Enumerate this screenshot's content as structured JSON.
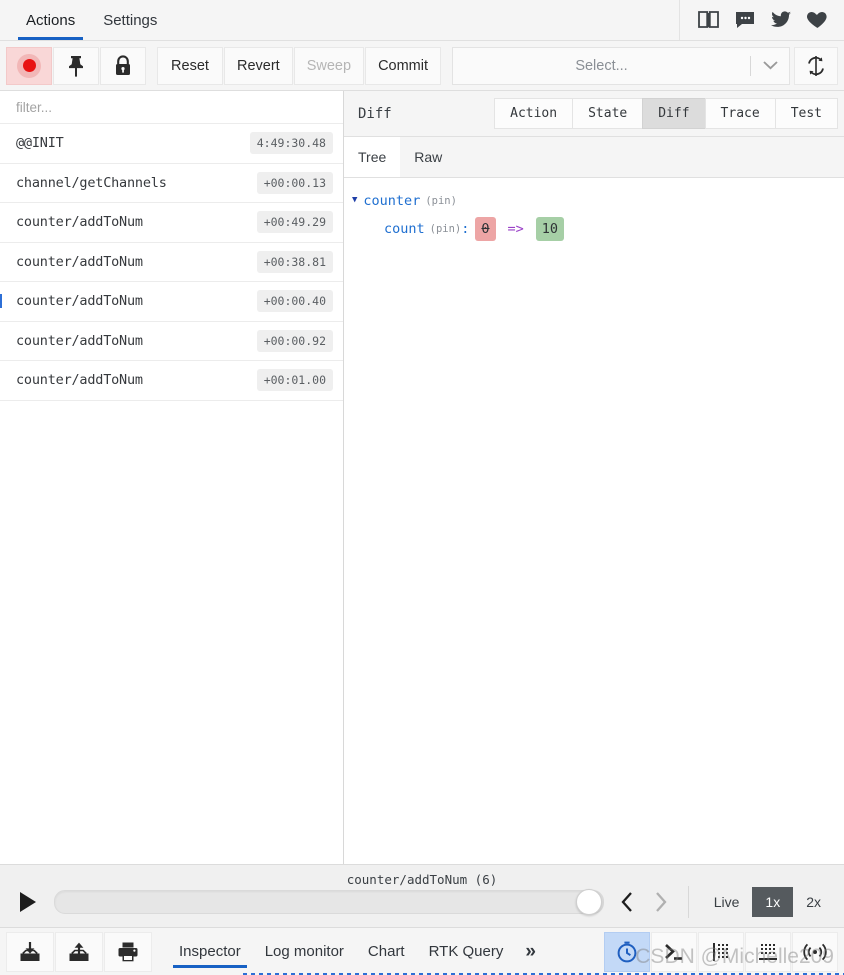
{
  "topbar": {
    "tabs": [
      {
        "label": "Actions",
        "active": true
      },
      {
        "label": "Settings",
        "active": false
      }
    ],
    "icons": [
      {
        "name": "book-icon"
      },
      {
        "name": "chat-bubble-icon"
      },
      {
        "name": "twitter-icon"
      },
      {
        "name": "heart-icon"
      }
    ]
  },
  "toolbar": {
    "record_label": "",
    "pin_label": "",
    "lock_label": "",
    "reset_label": "Reset",
    "revert_label": "Revert",
    "sweep_label": "Sweep",
    "commit_label": "Commit",
    "select_placeholder": "Select...",
    "refresh_label": ""
  },
  "actions": {
    "filter_placeholder": "filter...",
    "filter_value": "",
    "rows": [
      {
        "name": "@@INIT",
        "time": "4:49:30.48",
        "marked": false
      },
      {
        "name": "channel/getChannels",
        "time": "+00:00.13",
        "marked": false
      },
      {
        "name": "counter/addToNum",
        "time": "+00:49.29",
        "marked": false
      },
      {
        "name": "counter/addToNum",
        "time": "+00:38.81",
        "marked": false
      },
      {
        "name": "counter/addToNum",
        "time": "+00:00.40",
        "marked": true
      },
      {
        "name": "counter/addToNum",
        "time": "+00:00.92",
        "marked": false
      },
      {
        "name": "counter/addToNum",
        "time": "+00:01.00",
        "marked": false
      }
    ]
  },
  "inspector": {
    "title": "Diff",
    "segments": [
      {
        "label": "Action",
        "active": false
      },
      {
        "label": "State",
        "active": false
      },
      {
        "label": "Diff",
        "active": true
      },
      {
        "label": "Trace",
        "active": false
      },
      {
        "label": "Test",
        "active": false
      }
    ],
    "subtabs": [
      {
        "label": "Tree",
        "active": true
      },
      {
        "label": "Raw",
        "active": false
      }
    ],
    "tree": {
      "root_key": "counter",
      "root_pin": "(pin)",
      "child_key": "count",
      "child_pin": "(pin)",
      "colon": ":",
      "old_value": "0",
      "operator": "=>",
      "new_value": "10"
    }
  },
  "slider": {
    "caption": "counter/addToNum  (6)",
    "position_percent": 100,
    "speeds": [
      {
        "label": "Live",
        "active": false
      },
      {
        "label": "1x",
        "active": true
      },
      {
        "label": "2x",
        "active": false
      }
    ]
  },
  "bottombar": {
    "left_icons": [
      {
        "name": "import-icon"
      },
      {
        "name": "export-icon"
      },
      {
        "name": "print-icon"
      }
    ],
    "monitor_tabs": [
      {
        "label": "Inspector",
        "active": true
      },
      {
        "label": "Log monitor",
        "active": false
      },
      {
        "label": "Chart",
        "active": false
      },
      {
        "label": "RTK Query",
        "active": false
      }
    ],
    "more_label": "»",
    "right_icons": [
      {
        "name": "timer-icon",
        "active": true
      },
      {
        "name": "terminal-icon",
        "active": false
      },
      {
        "name": "dock-right-icon",
        "active": false
      },
      {
        "name": "dock-bottom-icon",
        "active": false
      },
      {
        "name": "remote-icon",
        "active": false
      }
    ]
  },
  "watermark": {
    "text": "CSDN @Michelle209"
  },
  "colors": {
    "accent_blue": "#1761c4",
    "record_red": "#e81313",
    "diff_old_bg": "#eda5a5",
    "diff_new_bg": "#a6cfa6",
    "diff_op": "#9a40c8",
    "key_blue": "#1f6fd0",
    "speed_active_bg": "#555a5e",
    "tool_active_bg": "#c3d9f7"
  }
}
